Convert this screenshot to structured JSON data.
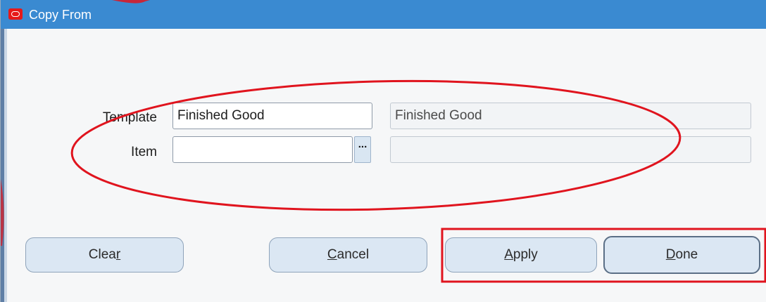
{
  "window": {
    "title": "Copy From"
  },
  "form": {
    "template_label": "Template",
    "template_value": "Finished Good",
    "template_description": "Finished Good",
    "item_label": "Item",
    "item_value": "",
    "item_description": "",
    "lov_symbol": "..."
  },
  "buttons": {
    "clear": {
      "label_pre": "Clea",
      "mnemonic": "r",
      "label_post": ""
    },
    "cancel": {
      "label_pre": "",
      "mnemonic": "C",
      "label_post": "ancel"
    },
    "apply": {
      "label_pre": "",
      "mnemonic": "A",
      "label_post": "pply"
    },
    "done": {
      "label_pre": "",
      "mnemonic": "D",
      "label_post": "one"
    }
  },
  "colors": {
    "titlebar": "#3a8ad1",
    "annotation": "#e0141e",
    "button_fill": "#dbe7f3"
  }
}
